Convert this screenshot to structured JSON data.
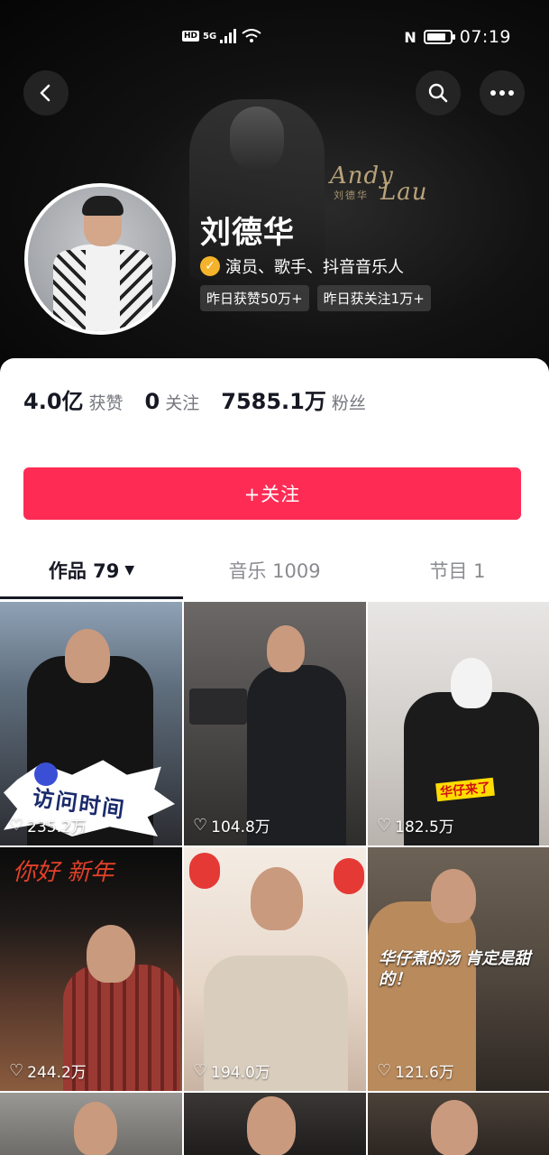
{
  "status_bar": {
    "left_badges": [
      "HD",
      "5G"
    ],
    "time": "07:19",
    "battery_level": 0.85,
    "nfc": "N"
  },
  "nav": {
    "back_icon": "back-arrow-icon",
    "search_icon": "search-icon",
    "more_icon": "more-dots-icon"
  },
  "banner": {
    "signature_andy": "Andy",
    "signature_lau": "Lau",
    "signature_cn": "刘德华"
  },
  "profile": {
    "name": "刘德华",
    "verified_desc": "演员、歌手、抖音音乐人",
    "tags": [
      "昨日获赞50万+",
      "昨日获关注1万+"
    ]
  },
  "stats": [
    {
      "value": "4.0亿",
      "label": "获赞"
    },
    {
      "value": "0",
      "label": "关注"
    },
    {
      "value": "7585.1万",
      "label": "粉丝"
    }
  ],
  "follow_button": "+关注",
  "tabs": [
    {
      "label": "作品 79",
      "active": true
    },
    {
      "label": "音乐 1009",
      "active": false
    },
    {
      "label": "节目 1",
      "active": false
    }
  ],
  "videos": [
    {
      "likes": "235.2万",
      "overlay_text": "访问时间"
    },
    {
      "likes": "104.8万",
      "overlay_text": ""
    },
    {
      "likes": "182.5万",
      "overlay_text": "华仔来了"
    },
    {
      "likes": "244.2万",
      "overlay_text": "你好 新年"
    },
    {
      "likes": "194.0万",
      "overlay_text": ""
    },
    {
      "likes": "121.6万",
      "overlay_text": "华仔煮的汤 肯定是甜的！"
    }
  ],
  "colors": {
    "accent": "#fe2c55",
    "verified_badge": "#f4b32a"
  }
}
